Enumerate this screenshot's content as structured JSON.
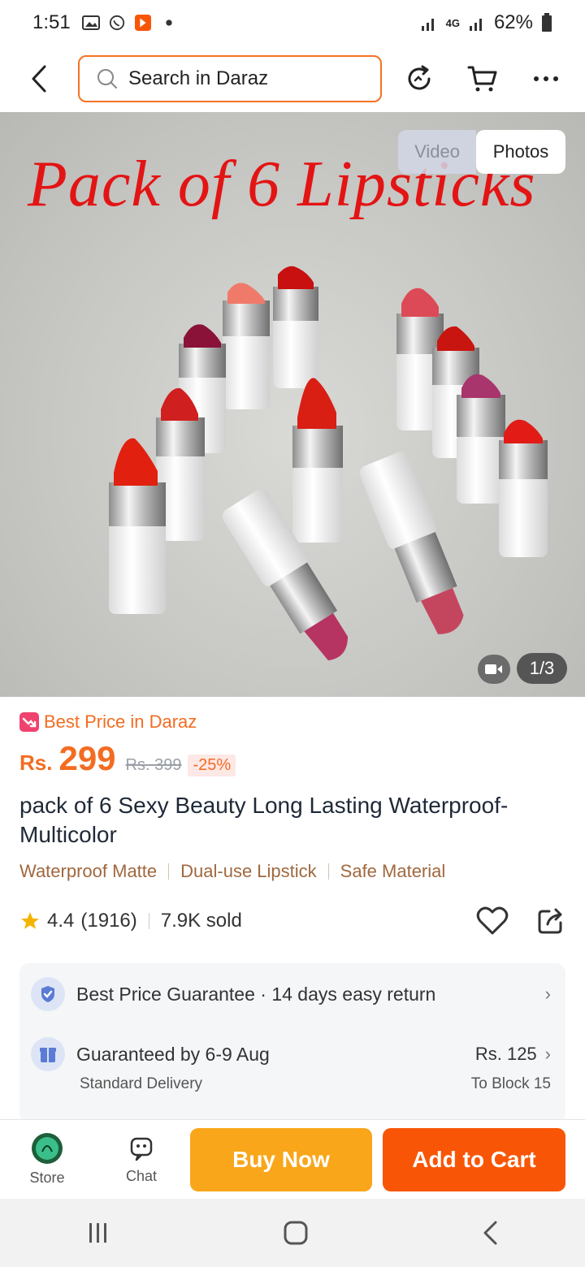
{
  "status_bar": {
    "time": "1:51",
    "network": "4G",
    "battery": "62%"
  },
  "top_nav": {
    "search_placeholder": "Search in Daraz"
  },
  "hero": {
    "overlay_title": "Pack of 6 Lipsticks",
    "toggle": {
      "video_label": "Video",
      "photos_label": "Photos",
      "selected": "Photos"
    },
    "page_counter": "1/3"
  },
  "price": {
    "badge_label": "Best Price in Daraz",
    "currency": "Rs.",
    "current": "299",
    "original": "Rs. 399",
    "discount": "-25%"
  },
  "product": {
    "title": "pack of 6 Sexy Beauty Long Lasting Waterproof-Multicolor",
    "tags": [
      "Waterproof Matte",
      "Dual-use Lipstick",
      "Safe Material"
    ],
    "rating": "4.4",
    "rating_count": "(1916)",
    "sold": "7.9K sold"
  },
  "info_card": {
    "guarantee_line": "Best Price Guarantee · 14 days easy return",
    "delivery_line": "Guaranteed by 6-9 Aug",
    "delivery_type": "Standard Delivery",
    "delivery_price": "Rs. 125",
    "delivery_to": "To Block 15"
  },
  "bottom_bar": {
    "store_label": "Store",
    "chat_label": "Chat",
    "buy_now_label": "Buy Now",
    "add_to_cart_label": "Add to Cart"
  },
  "colors": {
    "accent_orange": "#f85606",
    "buy_now_yellow": "#f9a61a",
    "price_orange": "#f36c21",
    "tag_brown": "#a0683f",
    "hero_title_red": "#e31414"
  }
}
